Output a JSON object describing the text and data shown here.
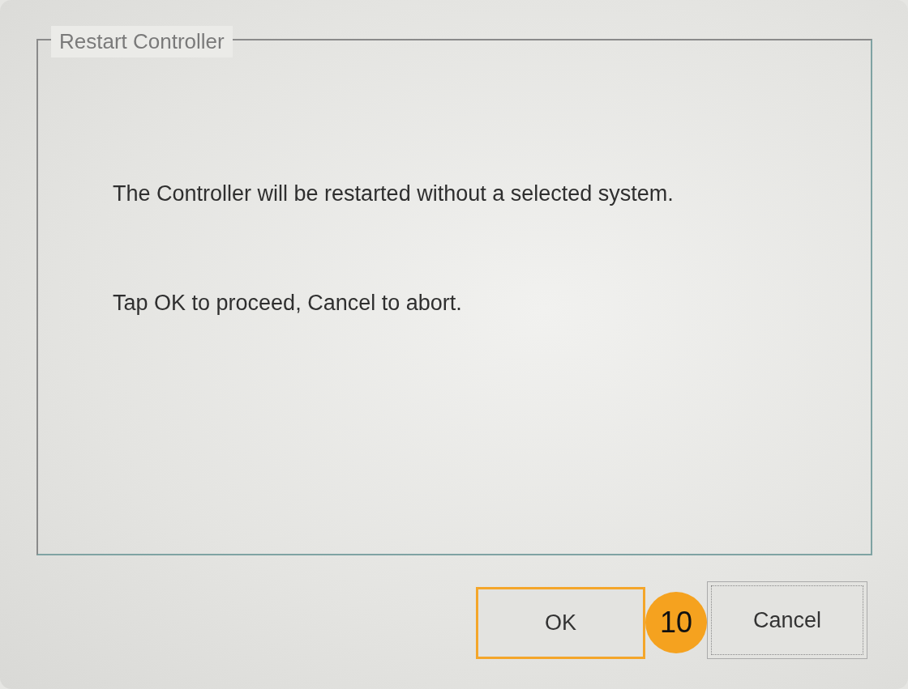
{
  "dialog": {
    "title": "Restart Controller",
    "messages": [
      "The Controller will be restarted without a selected system.",
      "Tap OK to proceed, Cancel to abort."
    ]
  },
  "buttons": [
    {
      "label": "OK",
      "highlighted": true
    },
    {
      "label": "Cancel",
      "highlighted": false
    }
  ],
  "step_badge": "10"
}
